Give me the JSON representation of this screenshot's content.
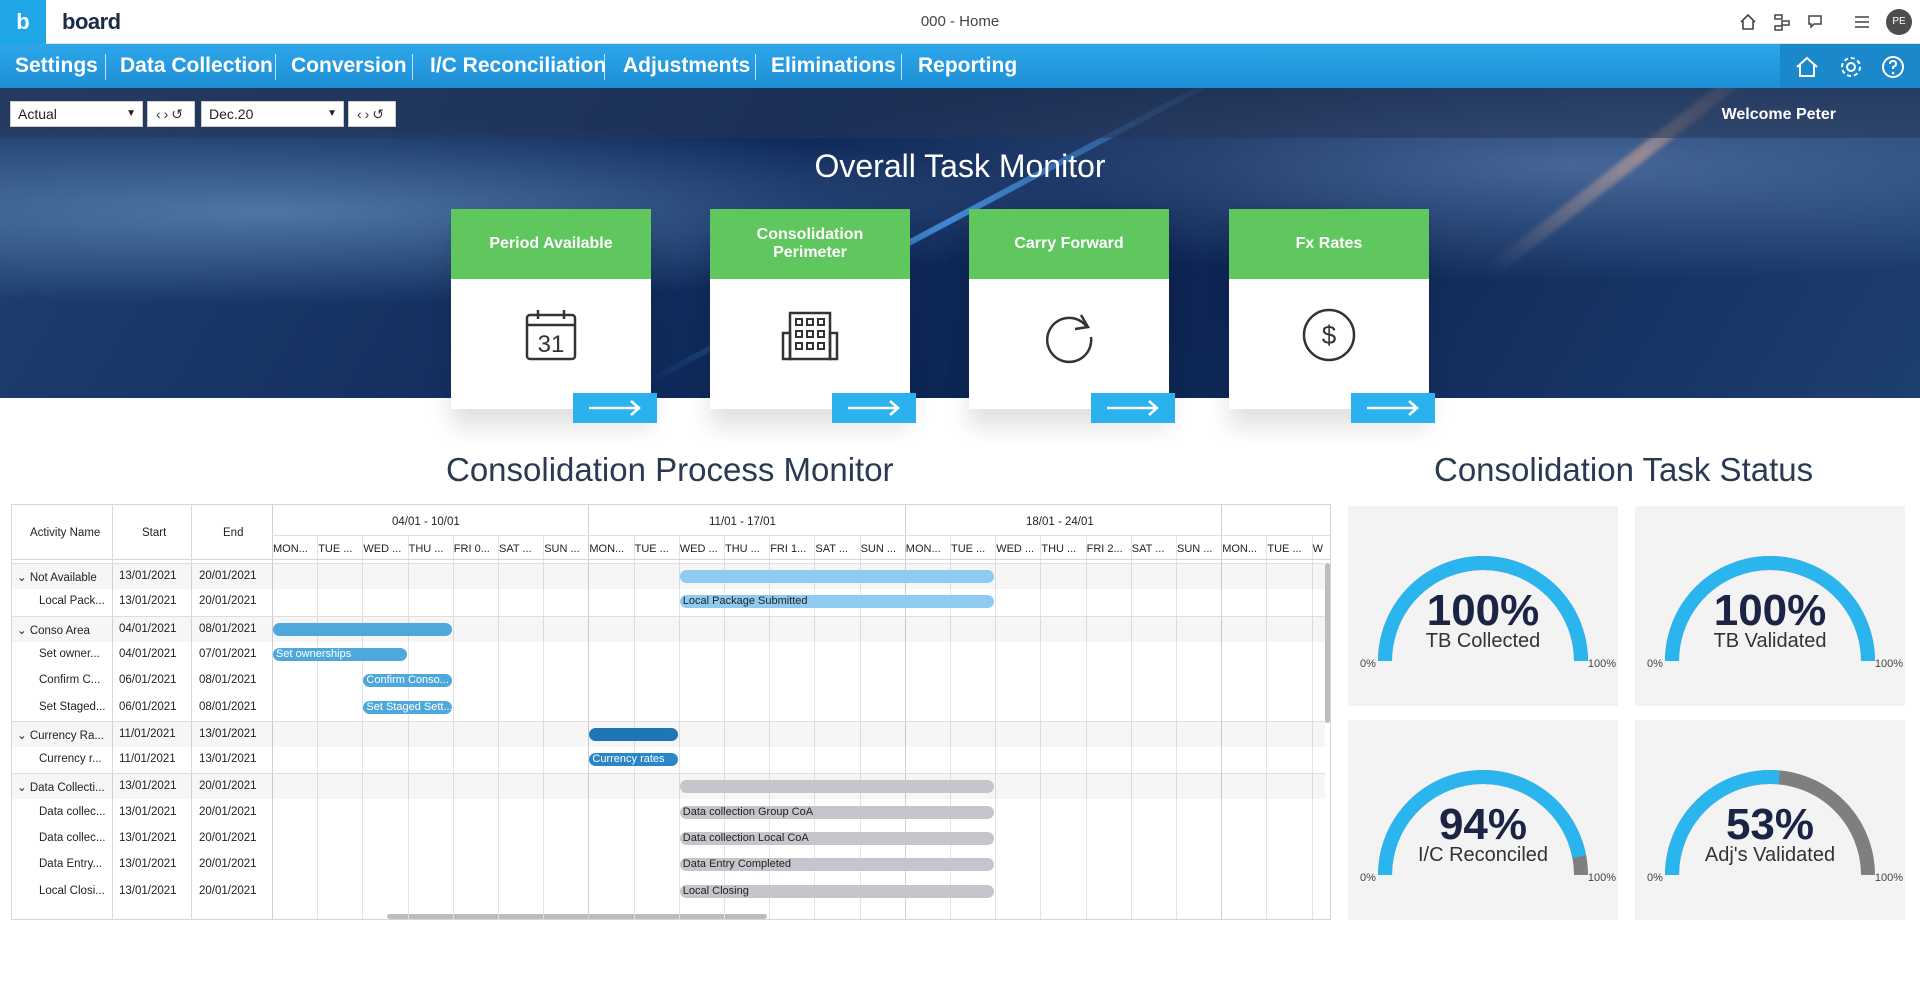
{
  "app": {
    "logo_letter": "b",
    "logo_text": "board",
    "window_title": "000 - Home",
    "avatar": "PE"
  },
  "nav": {
    "items": [
      "Settings",
      "Data Collection",
      "Conversion",
      "I/C Reconciliation",
      "Adjustments",
      "Eliminations",
      "Reporting"
    ]
  },
  "filters": {
    "scenario": "Actual",
    "period": "Dec.20",
    "welcome": "Welcome Peter"
  },
  "task_monitor": {
    "title": "Overall Task Monitor",
    "cards": [
      {
        "title": "Period Available",
        "icon": "calendar-icon",
        "icon_text": "31"
      },
      {
        "title": "Consolidation Perimeter",
        "icon": "building-icon"
      },
      {
        "title": "Carry Forward",
        "icon": "refresh-icon"
      },
      {
        "title": "Fx Rates",
        "icon": "dollar-icon",
        "icon_text": "$"
      }
    ]
  },
  "process_monitor": {
    "title": "Consolidation Process Monitor",
    "columns": [
      "Activity Name",
      "Start",
      "End"
    ],
    "weeks": [
      "04/01 - 10/01",
      "11/01 - 17/01",
      "18/01 - 24/01"
    ],
    "days": [
      "MON...",
      "TUE ...",
      "WED ...",
      "THU ...",
      "FRI 0...",
      "SAT ...",
      "SUN ...",
      "MON...",
      "TUE ...",
      "WED ...",
      "THU ...",
      "FRI 1...",
      "SAT ...",
      "SUN ...",
      "MON...",
      "TUE ...",
      "WED ...",
      "THU ...",
      "FRI 2...",
      "SAT ...",
      "SUN ...",
      "MON...",
      "TUE ...",
      "W"
    ],
    "rows": [
      {
        "name": "Not Available",
        "start": "13/01/2021",
        "end": "20/01/2021",
        "group": true,
        "bar": {
          "from": 9,
          "to": 16,
          "color": "#8fcaf0",
          "label": ""
        }
      },
      {
        "name": "Local Pack...",
        "start": "13/01/2021",
        "end": "20/01/2021",
        "group": false,
        "bar": {
          "from": 9,
          "to": 16,
          "color": "#8fcaf0",
          "label": "Local Package Submitted"
        }
      },
      {
        "name": "Conso Area",
        "start": "04/01/2021",
        "end": "08/01/2021",
        "group": true,
        "bar": {
          "from": 0,
          "to": 4,
          "color": "#4fa8dc",
          "label": ""
        }
      },
      {
        "name": "Set owner...",
        "start": "04/01/2021",
        "end": "07/01/2021",
        "group": false,
        "bar": {
          "from": 0,
          "to": 3,
          "color": "#4fa8dc",
          "label": "Set ownerships"
        }
      },
      {
        "name": "Confirm C...",
        "start": "06/01/2021",
        "end": "08/01/2021",
        "group": false,
        "bar": {
          "from": 2,
          "to": 4,
          "color": "#4fa8dc",
          "label": "Confirm Conso..."
        }
      },
      {
        "name": "Set Staged...",
        "start": "06/01/2021",
        "end": "08/01/2021",
        "group": false,
        "bar": {
          "from": 2,
          "to": 4,
          "color": "#4fa8dc",
          "label": "Set Staged Sett..."
        }
      },
      {
        "name": "Currency Ra...",
        "start": "11/01/2021",
        "end": "13/01/2021",
        "group": true,
        "bar": {
          "from": 7,
          "to": 9,
          "color": "#1f76b4",
          "label": ""
        }
      },
      {
        "name": "Currency r...",
        "start": "11/01/2021",
        "end": "13/01/2021",
        "group": false,
        "bar": {
          "from": 7,
          "to": 9,
          "color": "#2a86c6",
          "label": "Currency rates"
        }
      },
      {
        "name": "Data Collecti...",
        "start": "13/01/2021",
        "end": "20/01/2021",
        "group": true,
        "bar": {
          "from": 9,
          "to": 16,
          "color": "#c4c6cc",
          "label": ""
        }
      },
      {
        "name": "Data collec...",
        "start": "13/01/2021",
        "end": "20/01/2021",
        "group": false,
        "bar": {
          "from": 9,
          "to": 16,
          "color": "#c4c6cc",
          "label": "Data collection Group CoA"
        }
      },
      {
        "name": "Data collec...",
        "start": "13/01/2021",
        "end": "20/01/2021",
        "group": false,
        "bar": {
          "from": 9,
          "to": 16,
          "color": "#c4c6cc",
          "label": "Data collection Local CoA"
        }
      },
      {
        "name": "Data Entry...",
        "start": "13/01/2021",
        "end": "20/01/2021",
        "group": false,
        "bar": {
          "from": 9,
          "to": 16,
          "color": "#c4c6cc",
          "label": "Data Entry Completed"
        }
      },
      {
        "name": "Local Closi...",
        "start": "13/01/2021",
        "end": "20/01/2021",
        "group": false,
        "bar": {
          "from": 9,
          "to": 16,
          "color": "#c4c6cc",
          "label": "Local Closing"
        }
      }
    ]
  },
  "task_status": {
    "title": "Consolidation Task Status",
    "gauges": [
      {
        "value": "100%",
        "pct": 100,
        "label": "TB Collected",
        "min": "0%",
        "max": "100%"
      },
      {
        "value": "100%",
        "pct": 100,
        "label": "TB Validated",
        "min": "0%",
        "max": "100%"
      },
      {
        "value": "94%",
        "pct": 94,
        "label": "I/C Reconciled",
        "min": "0%",
        "max": "100%"
      },
      {
        "value": "53%",
        "pct": 53,
        "label": "Adj's Validated",
        "min": "0%",
        "max": "100%"
      }
    ],
    "colors": {
      "fill": "#2bb5ef",
      "rest": "#7f7f7f"
    }
  }
}
